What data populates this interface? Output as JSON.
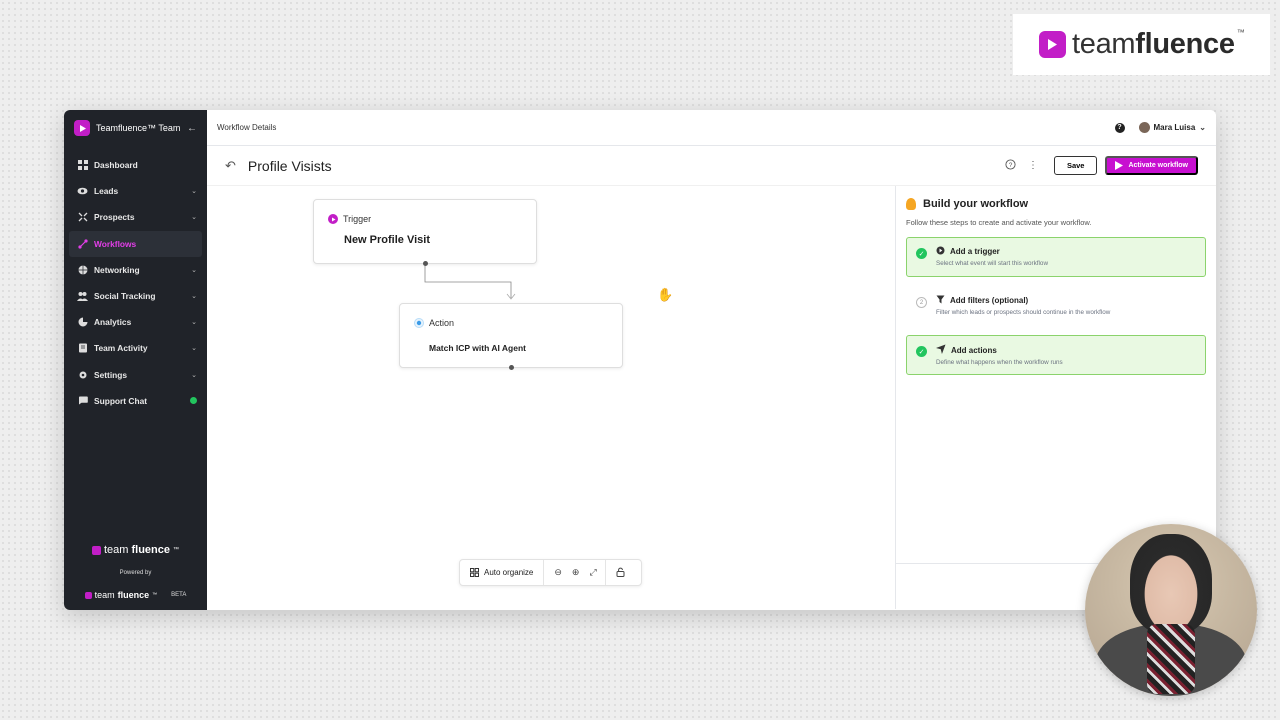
{
  "brand": {
    "light": "team",
    "bold": "fluence",
    "tm": "™"
  },
  "sidebar": {
    "team_name": "Teamfluence™ Team",
    "items": [
      {
        "label": "Dashboard",
        "icon": "grid-icon",
        "expandable": false
      },
      {
        "label": "Leads",
        "icon": "eye-icon",
        "expandable": true
      },
      {
        "label": "Prospects",
        "icon": "arrows-icon",
        "expandable": true
      },
      {
        "label": "Workflows",
        "icon": "workflow-icon",
        "expandable": false,
        "active": true
      },
      {
        "label": "Networking",
        "icon": "globe-icon",
        "expandable": true
      },
      {
        "label": "Social Tracking",
        "icon": "users-icon",
        "expandable": true
      },
      {
        "label": "Analytics",
        "icon": "pie-chart-icon",
        "expandable": true
      },
      {
        "label": "Team Activity",
        "icon": "book-icon",
        "expandable": true
      },
      {
        "label": "Settings",
        "icon": "gear-icon",
        "expandable": true
      },
      {
        "label": "Support Chat",
        "icon": "chat-icon",
        "expandable": false,
        "online": true
      }
    ],
    "footer": {
      "logo_light": "team",
      "logo_bold": "fluence",
      "tm": "™",
      "powered_by": "Powered by",
      "beta": "BETA"
    }
  },
  "topbar": {
    "breadcrumb": "Workflow Details",
    "user_name": "Mara Luisa"
  },
  "header": {
    "title": "Profile Visists",
    "save_label": "Save",
    "activate_label": "Activate workflow"
  },
  "canvas": {
    "trigger": {
      "type": "Trigger",
      "name": "New Profile Visit"
    },
    "action": {
      "type": "Action",
      "name": "Match ICP with AI Agent"
    },
    "toolbar": {
      "auto_organize": "Auto organize"
    }
  },
  "panel": {
    "title": "Build your workflow",
    "subtitle": "Follow these steps to create and activate your workflow.",
    "steps": [
      {
        "title": "Add a trigger",
        "desc": "Select what event will start this workflow",
        "status": "done",
        "number": ""
      },
      {
        "title": "Add filters (optional)",
        "desc": "Filter which leads or prospects should continue in the workflow",
        "status": "pending",
        "number": "2"
      },
      {
        "title": "Add actions",
        "desc": "Define what happens when the workflow runs",
        "status": "done",
        "number": ""
      }
    ]
  },
  "colors": {
    "accent": "#c70fd0",
    "sidebar_bg": "#202329",
    "success": "#22c55e",
    "step_done_bg": "#e9f9e2"
  }
}
